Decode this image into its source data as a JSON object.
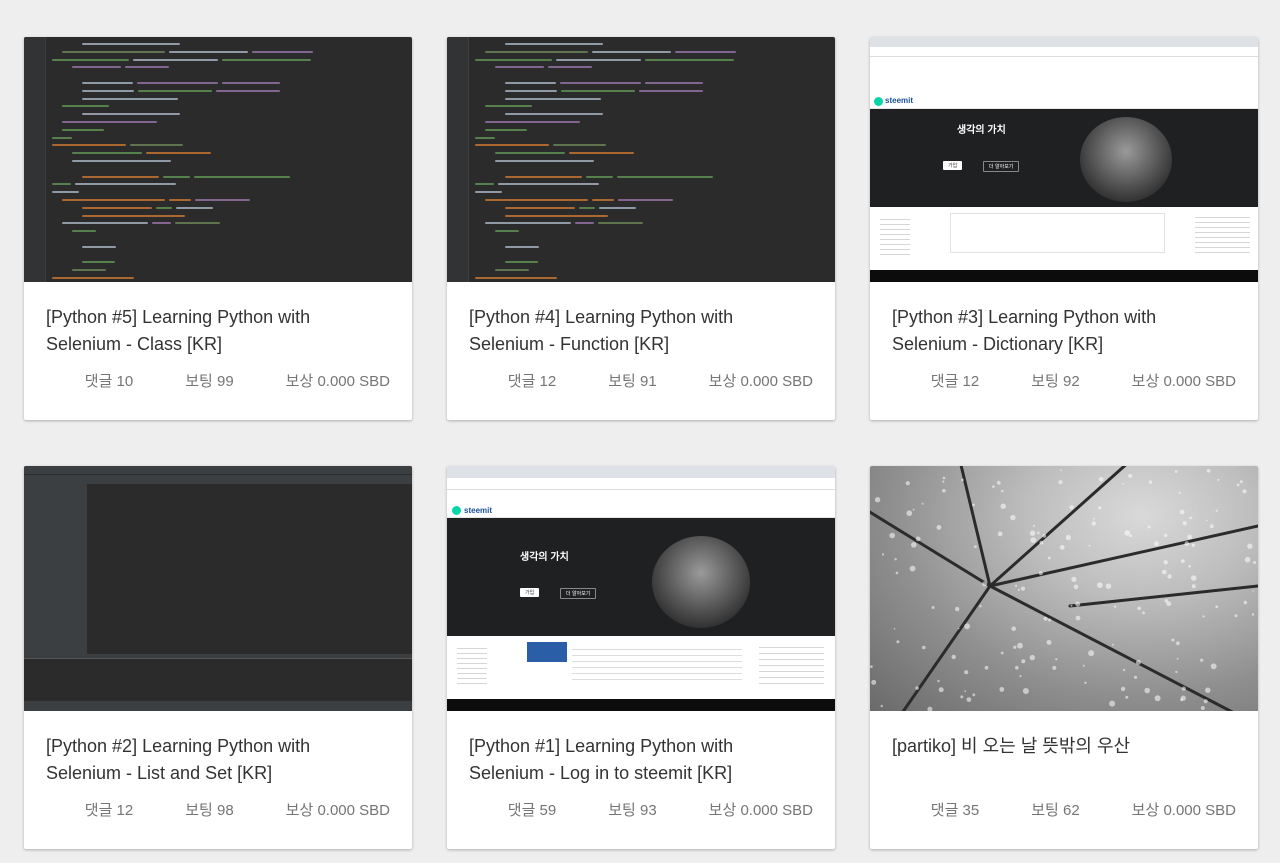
{
  "posts": [
    {
      "title": "[Python #5] Learning Python with Selenium - Class [KR]",
      "comments": "댓글 10",
      "votes": "보팅 99",
      "reward": "보상 0.000 SBD",
      "thumbnail": "code-editor-screenshot"
    },
    {
      "title": "[Python #4] Learning Python with Selenium - Function [KR]",
      "comments": "댓글 12",
      "votes": "보팅 91",
      "reward": "보상 0.000 SBD",
      "thumbnail": "code-editor-screenshot"
    },
    {
      "title": "[Python #3] Learning Python with Selenium - Dictionary [KR]",
      "comments": "댓글 12",
      "votes": "보팅 92",
      "reward": "보상 0.000 SBD",
      "thumbnail": "steemit-browser-screenshot"
    },
    {
      "title": "[Python #2] Learning Python with Selenium - List and Set [KR]",
      "comments": "댓글 12",
      "votes": "보팅 98",
      "reward": "보상 0.000 SBD",
      "thumbnail": "ide-screenshot"
    },
    {
      "title": "[Python #1] Learning Python with Selenium - Log in to steemit [KR]",
      "comments": "댓글 59",
      "votes": "보팅 93",
      "reward": "보상 0.000 SBD",
      "thumbnail": "steemit-browser-screenshot"
    },
    {
      "title": "[partiko] 비 오는 날 뜻밖의 우산",
      "comments": "댓글 35",
      "votes": "보팅 62",
      "reward": "보상 0.000 SBD",
      "thumbnail": "umbrella-photo"
    }
  ],
  "thumb_text": {
    "steemit_logo": "steemit",
    "hero_title": "생각의 가치",
    "hero_btn_join": "가입",
    "hero_btn_more": "더 알아보기"
  }
}
